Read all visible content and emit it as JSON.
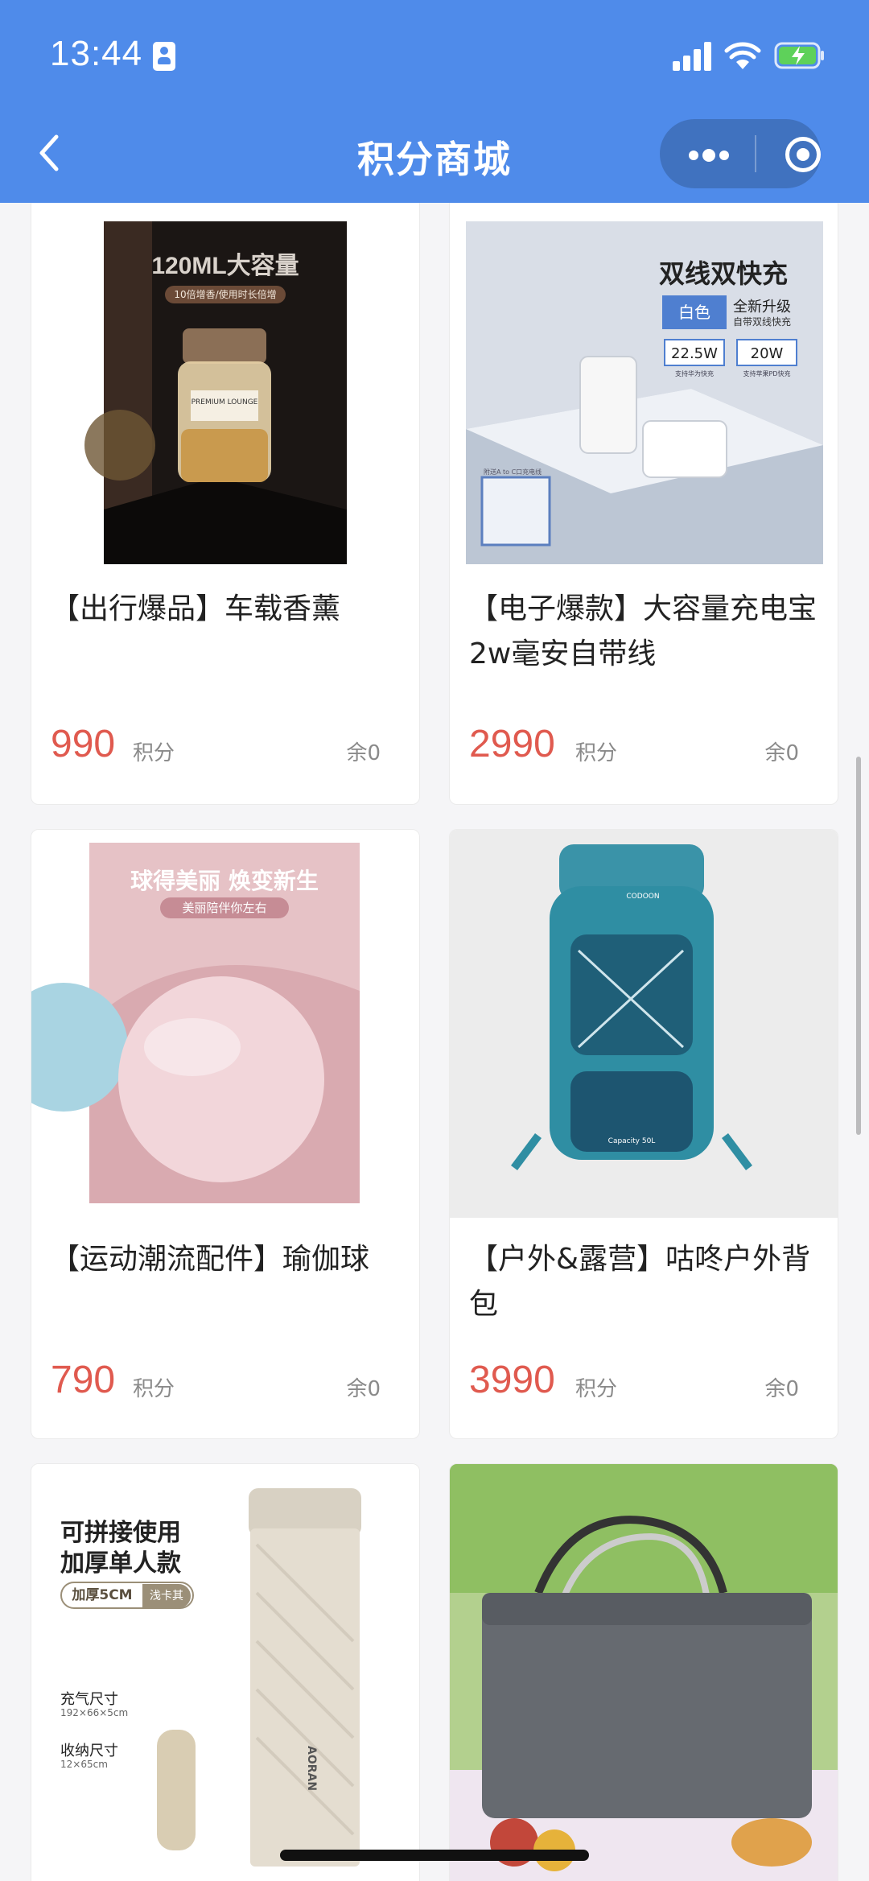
{
  "status_bar": {
    "time": "13:44"
  },
  "nav": {
    "title": "积分商城"
  },
  "colors": {
    "header": "#4f8bea",
    "price": "#e05a4f"
  },
  "products": [
    {
      "name": "【出行爆品】车载香薰",
      "price": "990",
      "unit": "积分",
      "stock": "余0",
      "image_text": {
        "headline": "120ML大容量",
        "sub": "10倍增香/使用时长倍增",
        "label": "PREMIUM LOUNGE"
      }
    },
    {
      "name": "【电子爆款】大容量充电宝2w毫安自带线",
      "price": "2990",
      "unit": "积分",
      "stock": "余0",
      "image_text": {
        "headline": "双线双快充",
        "color_tag": "白色",
        "upgrade": "全新升级",
        "upgrade_sub": "自带双线快充",
        "spec1": "22.5W",
        "spec1_sub": "支持华为快充",
        "spec2": "20W",
        "spec2_sub": "支持苹果PD快充",
        "cable_note": "附送A to C口充电线"
      }
    },
    {
      "name": "【运动潮流配件】瑜伽球",
      "price": "790",
      "unit": "积分",
      "stock": "余0",
      "image_text": {
        "headline": "球得美丽 焕变新生",
        "sub": "美丽陪伴你左右"
      }
    },
    {
      "name": "【户外&露营】咕咚户外背包",
      "price": "3990",
      "unit": "积分",
      "stock": "余0",
      "image_text": {
        "brand": "CODOON",
        "capacity": "Capacity 50L"
      }
    },
    {
      "name": "",
      "image_text": {
        "line1": "可拼接使用",
        "line2": "加厚单人款",
        "tag1": "加厚5CM",
        "tag2": "浅卡其",
        "inflate_label": "充气尺寸",
        "inflate_size": "192×66×5cm",
        "pack_label": "收纳尺寸",
        "pack_size": "12×65cm",
        "brand": "AORAN"
      }
    },
    {
      "name": "",
      "image_text": {}
    }
  ]
}
